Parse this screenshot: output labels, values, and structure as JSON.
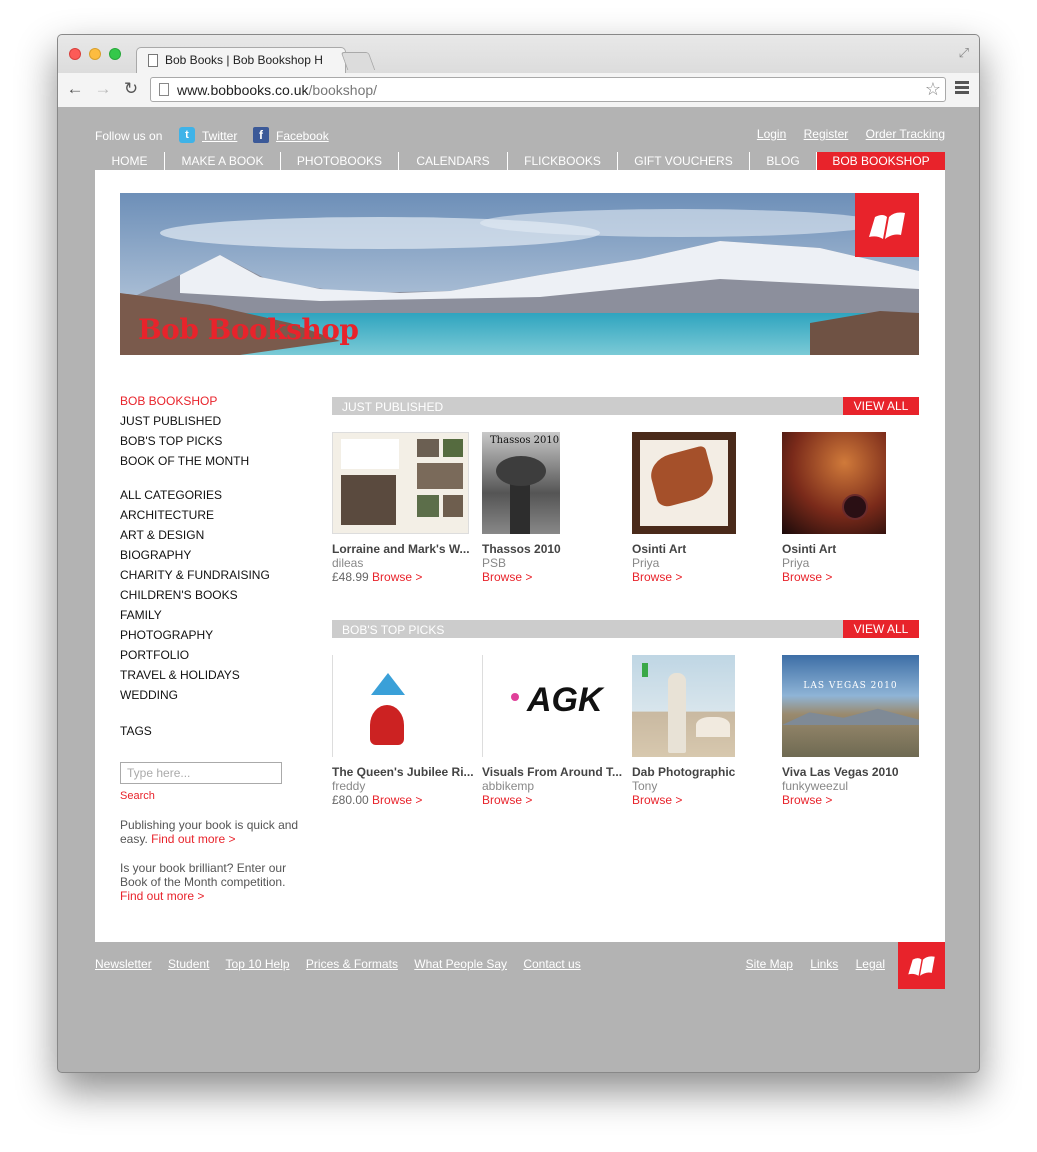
{
  "browser": {
    "tab_title": "Bob Books | Bob Bookshop H",
    "url_host": "www.bobbooks.co.uk",
    "url_path": "/bookshop/"
  },
  "header": {
    "follow_label": "Follow us on",
    "twitter": "Twitter",
    "facebook": "Facebook",
    "login": "Login",
    "register": "Register",
    "order_tracking": "Order Tracking"
  },
  "nav": [
    "HOME",
    "MAKE A BOOK",
    "PHOTOBOOKS",
    "CALENDARS",
    "FLICKBOOKS",
    "GIFT VOUCHERS",
    "BLOG",
    "BOB BOOKSHOP"
  ],
  "banner": {
    "title": "Bob Bookshop"
  },
  "sidebar": {
    "top": [
      "BOB BOOKSHOP",
      "JUST PUBLISHED",
      "BOB'S TOP PICKS",
      "BOOK OF THE MONTH"
    ],
    "categories": [
      "ALL CATEGORIES",
      "ARCHITECTURE",
      "ART & DESIGN",
      "BIOGRAPHY",
      "CHARITY & FUNDRAISING",
      "CHILDREN'S BOOKS",
      "FAMILY",
      "PHOTOGRAPHY",
      "PORTFOLIO",
      "TRAVEL & HOLIDAYS",
      "WEDDING"
    ],
    "tags": "TAGS",
    "search_placeholder": "Type here...",
    "search_button": "Search",
    "blurb1": "Publishing your book is quick and easy.",
    "blurb1_link": "Find out more >",
    "blurb2": "Is your book brilliant? Enter our Book of the Month competition.",
    "blurb2_link": "Find out more >"
  },
  "sections": [
    {
      "title": "JUST PUBLISHED",
      "view_all": "VIEW ALL",
      "books": [
        {
          "title": "Lorraine and Mark's W...",
          "author": "dileas",
          "price": "£48.99",
          "browse": "Browse >"
        },
        {
          "title": "Thassos 2010",
          "author": "PSB",
          "price": "",
          "browse": "Browse >",
          "cover_text": "Thassos 2010"
        },
        {
          "title": "Osinti Art",
          "author": "Priya",
          "price": "",
          "browse": "Browse >"
        },
        {
          "title": "Osinti Art",
          "author": "Priya",
          "price": "",
          "browse": "Browse >"
        }
      ]
    },
    {
      "title": "BOB'S TOP PICKS",
      "view_all": "VIEW ALL",
      "books": [
        {
          "title": "The Queen's Jubilee Ri...",
          "author": "freddy",
          "price": "£80.00",
          "browse": "Browse >"
        },
        {
          "title": "Visuals From Around T...",
          "author": "abbikemp",
          "price": "",
          "browse": "Browse >",
          "cover_text": "AGK"
        },
        {
          "title": "Dab Photographic",
          "author": "Tony",
          "price": "",
          "browse": "Browse >"
        },
        {
          "title": "Viva Las Vegas 2010",
          "author": "funkyweezul",
          "price": "",
          "browse": "Browse >",
          "cover_text": "LAS VEGAS 2010"
        }
      ]
    }
  ],
  "footer": {
    "left": [
      "Newsletter",
      "Student",
      "Top 10 Help",
      "Prices & Formats",
      "What People Say",
      "Contact us"
    ],
    "right": [
      "Site Map",
      "Links",
      "Legal"
    ]
  },
  "colors": {
    "accent": "#e8232b",
    "page_bg": "#b3b3b3",
    "section_bar": "#cccccc"
  }
}
